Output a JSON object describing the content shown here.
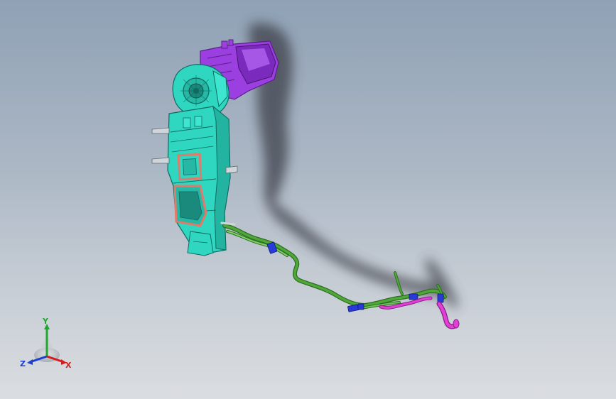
{
  "viewport": {
    "background_top": "#8fa1b5",
    "background_bottom": "#dadde1"
  },
  "model": {
    "colors": {
      "intake": "#9b3fe0",
      "housing": "#2fd6c0",
      "gasket": "#e07a6a",
      "harness": "#4fa83a",
      "clip": "#2a3ad8",
      "drain": "#e040d6",
      "shadow": "#3c4148"
    }
  },
  "triad": {
    "x_label": "X",
    "y_label": "Y",
    "z_label": "Z",
    "x_color": "#d21e1e",
    "y_color": "#1ea82e",
    "z_color": "#1e3ed2"
  }
}
